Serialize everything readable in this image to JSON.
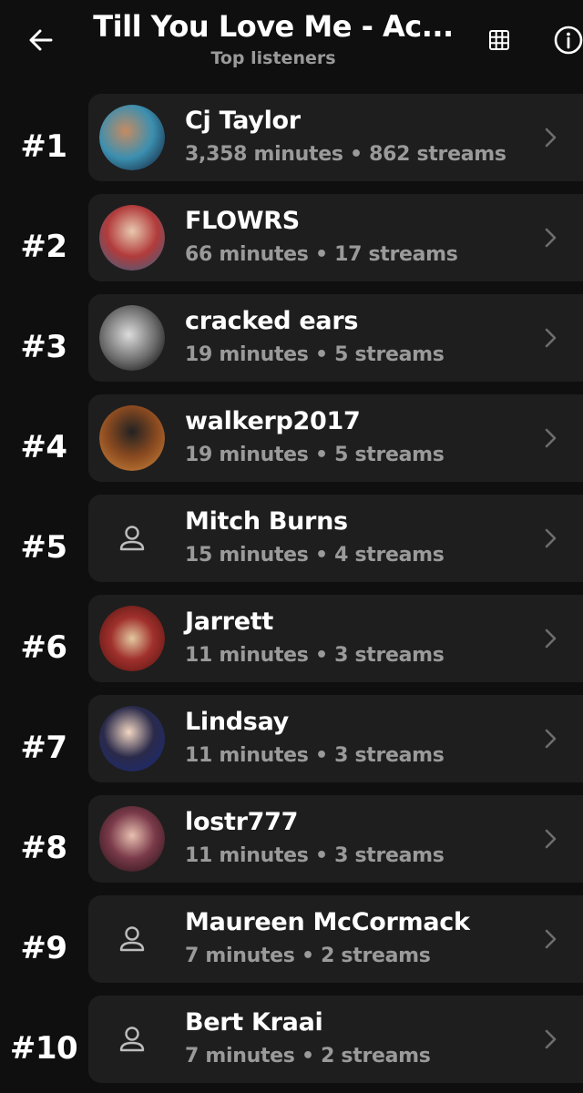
{
  "header": {
    "title": "Till You Love Me - Ac...",
    "subtitle": "Top listeners",
    "back_icon": "arrow-left-icon",
    "grid_icon": "grid-icon",
    "info_icon": "info-icon"
  },
  "colors": {
    "background": "#0f0f0f",
    "card": "#1e1e1e",
    "text_primary": "#ffffff",
    "text_secondary": "#9a9a9a"
  },
  "listeners": [
    {
      "rank": "#1",
      "name": "Cj Taylor",
      "stats": "3,358 minutes • 862 streams",
      "avatar": "photo"
    },
    {
      "rank": "#2",
      "name": "FLOWRS",
      "stats": "66 minutes • 17 streams",
      "avatar": "photo"
    },
    {
      "rank": "#3",
      "name": "cracked ears",
      "stats": "19 minutes • 5 streams",
      "avatar": "photo"
    },
    {
      "rank": "#4",
      "name": "walkerp2017",
      "stats": "19 minutes • 5 streams",
      "avatar": "photo"
    },
    {
      "rank": "#5",
      "name": "Mitch Burns",
      "stats": "15 minutes • 4 streams",
      "avatar": "person-icon"
    },
    {
      "rank": "#6",
      "name": "Jarrett",
      "stats": "11 minutes • 3 streams",
      "avatar": "photo"
    },
    {
      "rank": "#7",
      "name": "Lindsay",
      "stats": "11 minutes • 3 streams",
      "avatar": "photo"
    },
    {
      "rank": "#8",
      "name": "lostr777",
      "stats": "11 minutes • 3 streams",
      "avatar": "photo"
    },
    {
      "rank": "#9",
      "name": "Maureen McCormack",
      "stats": "7 minutes • 2 streams",
      "avatar": "person-icon"
    },
    {
      "rank": "#10",
      "name": "Bert Kraai",
      "stats": "7 minutes • 2 streams",
      "avatar": "person-icon"
    }
  ]
}
